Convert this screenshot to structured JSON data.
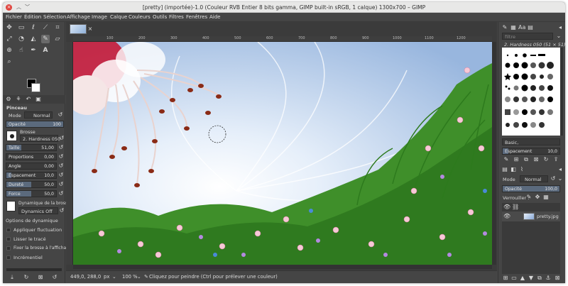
{
  "window": {
    "title": "[pretty] (importée)-1.0 (Couleur RVB Entier 8 bits gamma, GIMP built-in sRGB, 1 calque) 1300x700 – GIMP"
  },
  "menu": [
    "Fichier",
    "Édition",
    "Sélection",
    "Affichage",
    "Image",
    "Calque",
    "Couleurs",
    "Outils",
    "Filtres",
    "Fenêtres",
    "Aide"
  ],
  "tool_options": {
    "title": "Pinceau",
    "mode_label": "Mode",
    "mode_value": "Normal",
    "opacity_label": "Opacité",
    "opacity_value": "100",
    "brush_label": "Brosse",
    "brush_value": "2. Hardness 050",
    "sliders": [
      {
        "label": "Taille",
        "value": "51,00",
        "fill": 0.51
      },
      {
        "label": "Proportions",
        "value": "0,00",
        "fill": 0.5
      },
      {
        "label": "Angle",
        "value": "0,00",
        "fill": 0.5
      },
      {
        "label": "Espacement",
        "value": "10,0",
        "fill": 0.1
      },
      {
        "label": "Dureté",
        "value": "50,0",
        "fill": 0.5
      },
      {
        "label": "Force",
        "value": "50,0",
        "fill": 0.5
      }
    ],
    "dynamics_label": "Dynamique de la brosse",
    "dynamics_value": "Dynamics Off",
    "dynamics_options": "Options de dynamique",
    "checkboxes": [
      "Appliquer fluctuation",
      "Lisser le tracé",
      "Fixer la brosse à l'affichage",
      "Incrémentiel"
    ]
  },
  "ruler_ticks": [
    "100",
    "200",
    "300",
    "400",
    "500",
    "600",
    "700",
    "800",
    "900",
    "1000",
    "1100",
    "1200"
  ],
  "status": {
    "coords": "449,0, 288,0",
    "unit": "px",
    "zoom": "100 %",
    "message": "Cliquez pour peindre (Ctrl pour prélever une couleur)"
  },
  "brushes_panel": {
    "filter_placeholder": "filtre",
    "selected_brush": "2. Hardness 050 (51 × 51)",
    "preset": "Basic,",
    "spacing_label": "Espacement",
    "spacing_value": "10,0"
  },
  "layers_panel": {
    "mode_label": "Mode",
    "mode_value": "Normal",
    "opacity_label": "Opacité",
    "opacity_value": "100,0",
    "lock_label": "Verrouiller :",
    "layer_name": "pretty.jpg"
  },
  "colors": {
    "foreground": "#000000",
    "background": "#ffffff",
    "accent": "#5b6a7d"
  }
}
